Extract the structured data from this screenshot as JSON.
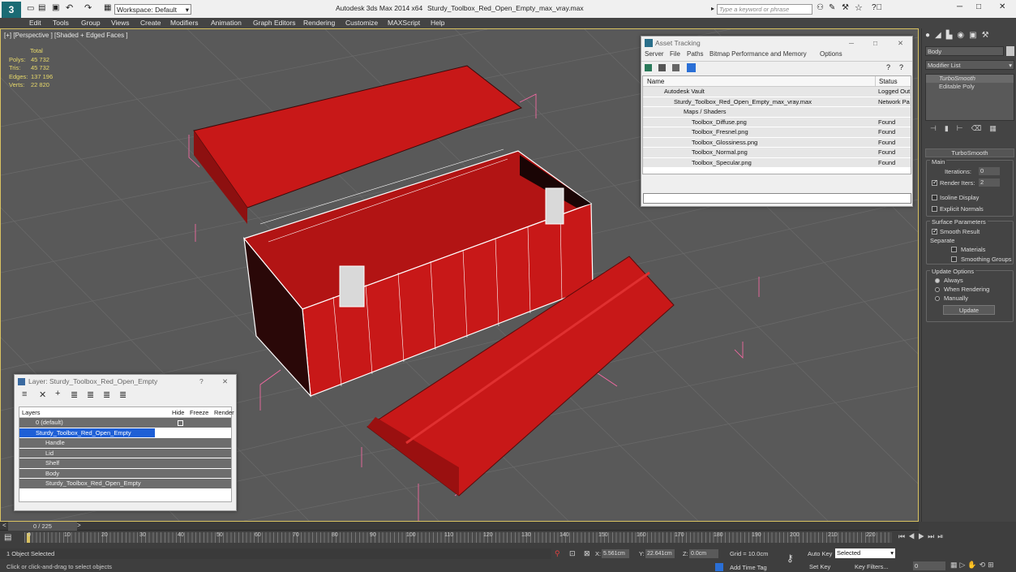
{
  "titlebar": {
    "workspace": "Workspace: Default",
    "app": "Autodesk 3ds Max  2014 x64",
    "file": "Sturdy_Toolbox_Red_Open_Empty_max_vray.max",
    "search_placeholder": "Type a keyword or phrase"
  },
  "menu": [
    "Edit",
    "Tools",
    "Group",
    "Views",
    "Create",
    "Modifiers",
    "Animation",
    "Graph Editors",
    "Rendering",
    "Customize",
    "MAXScript",
    "Help"
  ],
  "viewport": {
    "label": "[+] [Perspective ] [Shaded + Edged Faces ]",
    "stats": {
      "header": "Total",
      "polys_label": "Polys:",
      "polys": "45 732",
      "tris_label": "Tris:",
      "tris": "45 732",
      "edges_label": "Edges:",
      "edges": "137 196",
      "verts_label": "Verts:",
      "verts": "22 820"
    }
  },
  "asset": {
    "title": "Asset Tracking",
    "menu": [
      "Server",
      "File",
      "Paths",
      "Bitmap Performance and Memory",
      "Options"
    ],
    "col_name": "Name",
    "col_status": "Status",
    "rows": [
      {
        "name": "Autodesk Vault",
        "status": "Logged Out"
      },
      {
        "name": "Sturdy_Toolbox_Red_Open_Empty_max_vray.max",
        "status": "Network Pa"
      },
      {
        "name": "Maps / Shaders",
        "status": ""
      },
      {
        "name": "Toolbox_Diffuse.png",
        "status": "Found"
      },
      {
        "name": "Toolbox_Fresnel.png",
        "status": "Found"
      },
      {
        "name": "Toolbox_Glossiness.png",
        "status": "Found"
      },
      {
        "name": "Toolbox_Normal.png",
        "status": "Found"
      },
      {
        "name": "Toolbox_Specular.png",
        "status": "Found"
      }
    ]
  },
  "layer": {
    "title": "Layer: Sturdy_Toolbox_Red_Open_Empty",
    "help": "?",
    "col_layers": "Layers",
    "col_hide": "Hide",
    "col_freeze": "Freeze",
    "col_render": "Render",
    "rows": [
      {
        "name": "0 (default)"
      },
      {
        "name": "Sturdy_Toolbox_Red_Open_Empty"
      },
      {
        "name": "Handle"
      },
      {
        "name": "Lid"
      },
      {
        "name": "Shelf"
      },
      {
        "name": "Body"
      },
      {
        "name": "Sturdy_Toolbox_Red_Open_Empty"
      }
    ]
  },
  "panel": {
    "object_name": "Body",
    "modifier_list": "Modifier List",
    "stack": [
      "TurboSmooth",
      "Editable Poly"
    ],
    "rollout": "TurboSmooth",
    "main": "Main",
    "iterations_label": "Iterations:",
    "iterations": "0",
    "render_iters_label": "Render Iters:",
    "render_iters": "2",
    "isoline": "Isoline Display",
    "explicit": "Explicit Normals",
    "surface": "Surface Parameters",
    "smooth_result": "Smooth Result",
    "separate": "Separate",
    "materials": "Materials",
    "smoothing_groups": "Smoothing Groups",
    "update_options": "Update Options",
    "always": "Always",
    "when_rendering": "When Rendering",
    "manually": "Manually",
    "update": "Update"
  },
  "timeline": {
    "frame": "0 / 225",
    "ticks": [
      "0",
      "10",
      "20",
      "30",
      "40",
      "50",
      "60",
      "70",
      "80",
      "90",
      "100",
      "110",
      "120",
      "130",
      "140",
      "150",
      "160",
      "170",
      "180",
      "190",
      "200",
      "210",
      "220"
    ]
  },
  "status": {
    "selected": "1 Object Selected",
    "prompt": "Click or click-and-drag to select objects",
    "x_label": "X:",
    "x": "5.561cm",
    "y_label": "Y:",
    "y": "22.641cm",
    "z_label": "Z:",
    "z": "0.0cm",
    "grid": "Grid = 10.0cm",
    "add_time_tag": "Add Time Tag",
    "auto_key": "Auto Key",
    "selected_opt": "Selected",
    "set_key": "Set Key",
    "key_filters": "Key Filters...",
    "frame_field": "0"
  },
  "colors": {
    "accent": "#d9c261",
    "selection": "#1e5fd6",
    "model": "#c81818"
  }
}
